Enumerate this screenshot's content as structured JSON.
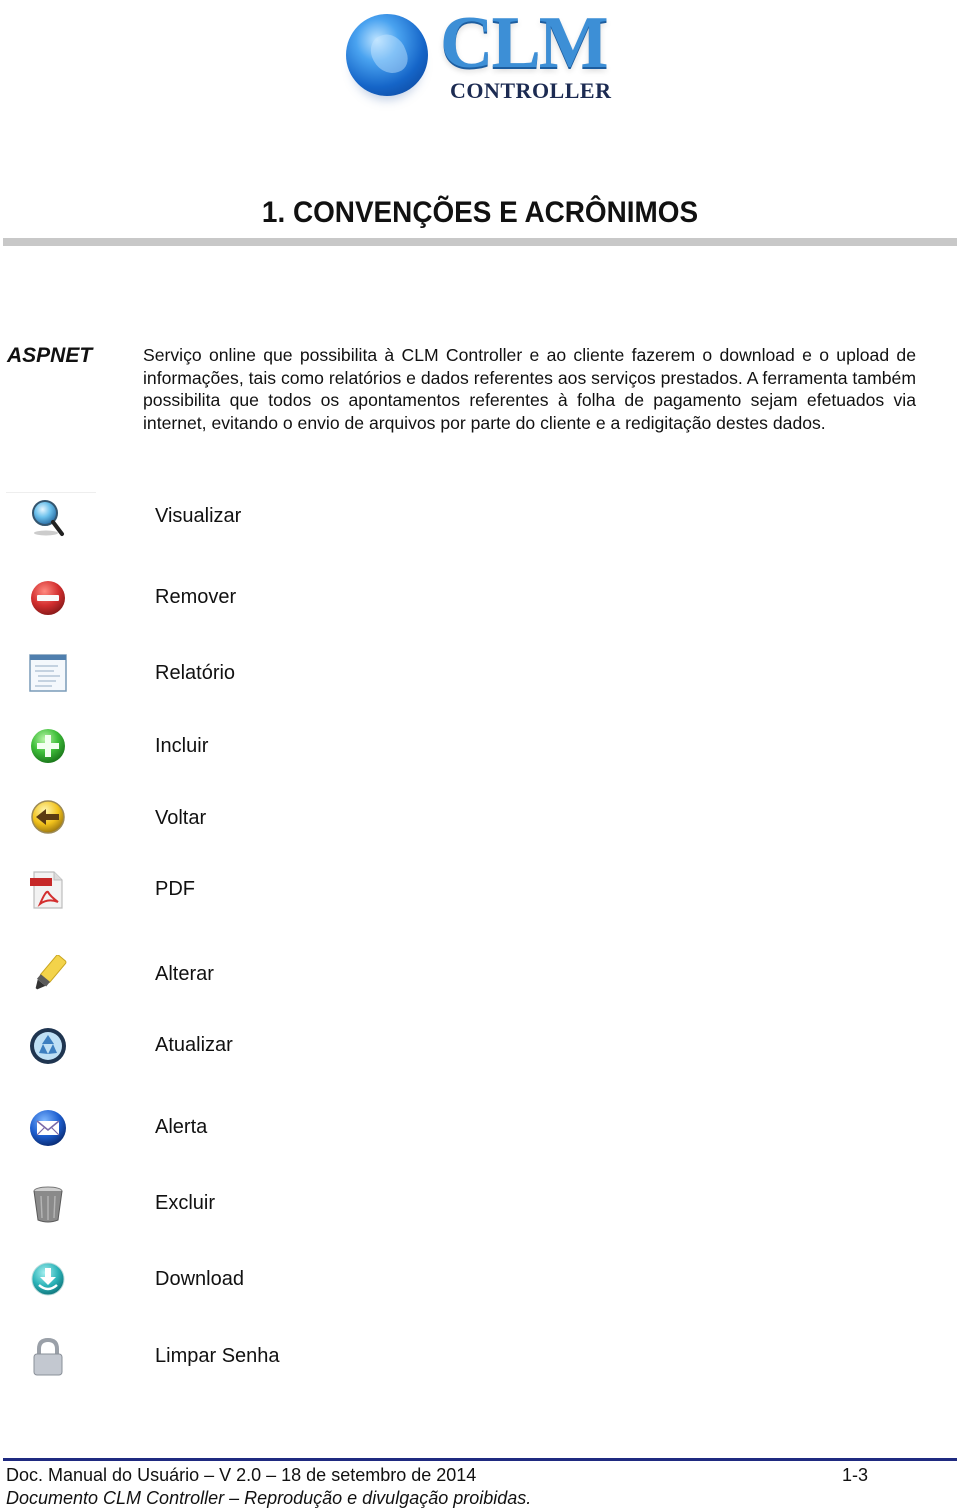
{
  "logo": {
    "name": "CLM",
    "subtitle": "CONTROLLER"
  },
  "section_title": "1. CONVENÇÕES E ACRÔNIMOS",
  "definition": {
    "term": "ASPNET",
    "text": "Serviço online que possibilita à CLM Controller e ao cliente fazerem o download e o upload de informações, tais como relatórios e dados referentes aos serviços prestados. A ferramenta também possibilita que todos os apontamentos referentes à folha de pagamento sejam efetuados via internet, evitando o envio de arquivos por parte do cliente e a redigitação destes dados."
  },
  "icons": [
    {
      "icon": "magnifier-icon",
      "label": "Visualizar"
    },
    {
      "icon": "remove-icon",
      "label": "Remover"
    },
    {
      "icon": "report-icon",
      "label": "Relatório"
    },
    {
      "icon": "add-icon",
      "label": "Incluir"
    },
    {
      "icon": "back-arrow-icon",
      "label": "Voltar"
    },
    {
      "icon": "pdf-icon",
      "label": "PDF"
    },
    {
      "icon": "pencil-icon",
      "label": "Alterar"
    },
    {
      "icon": "refresh-icon",
      "label": "Atualizar"
    },
    {
      "icon": "envelope-icon",
      "label": "Alerta"
    },
    {
      "icon": "trash-icon",
      "label": "Excluir"
    },
    {
      "icon": "download-icon",
      "label": "Download"
    },
    {
      "icon": "lock-icon",
      "label": "Limpar Senha"
    }
  ],
  "footer": {
    "doc": "Doc. Manual do Usuário – V 2.0 – 18 de setembro de 2014",
    "page": "1-3",
    "note": "Documento CLM Controller – Reprodução e divulgação proibidas."
  }
}
